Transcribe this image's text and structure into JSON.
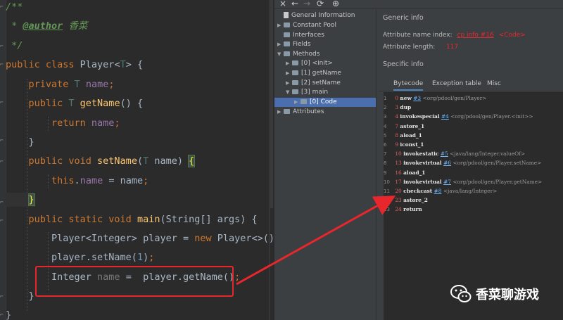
{
  "editor": {
    "lines": [
      {
        "segments": [
          {
            "t": "/**",
            "c": "cmt"
          }
        ]
      },
      {
        "segments": [
          {
            "t": " * ",
            "c": "cmt"
          },
          {
            "t": "@author",
            "c": "tag"
          },
          {
            "t": " 香菜",
            "c": "cmt"
          }
        ]
      },
      {
        "segments": [
          {
            "t": " */",
            "c": "cmt"
          }
        ]
      },
      {
        "segments": [
          {
            "t": "public class ",
            "c": "kw"
          },
          {
            "t": "Player",
            "c": ""
          },
          {
            "t": "<",
            "c": ""
          },
          {
            "t": "T",
            "c": "tp"
          },
          {
            "t": "> {",
            "c": ""
          }
        ]
      },
      {
        "segments": [
          {
            "t": "    private ",
            "c": "kw"
          },
          {
            "t": "T ",
            "c": "tp"
          },
          {
            "t": "name",
            "c": "fld"
          },
          {
            "t": ";",
            "c": "kw"
          }
        ]
      },
      {
        "segments": [
          {
            "t": "    public ",
            "c": "kw"
          },
          {
            "t": "T ",
            "c": "tp"
          },
          {
            "t": "getName",
            "c": "fn"
          },
          {
            "t": "() {",
            "c": ""
          }
        ]
      },
      {
        "segments": [
          {
            "t": "        return ",
            "c": "kw"
          },
          {
            "t": "name",
            "c": "fld"
          },
          {
            "t": ";",
            "c": "kw"
          }
        ]
      },
      {
        "segments": [
          {
            "t": "    }",
            "c": ""
          }
        ]
      },
      {
        "segments": [
          {
            "t": "    public void ",
            "c": "kw"
          },
          {
            "t": "setName",
            "c": "fn"
          },
          {
            "t": "(",
            "c": ""
          },
          {
            "t": "T ",
            "c": "tp"
          },
          {
            "t": "name) ",
            "c": ""
          },
          {
            "t": "{",
            "c": "brace-hl"
          }
        ]
      },
      {
        "segments": [
          {
            "t": "        this",
            "c": "kw"
          },
          {
            "t": ".",
            "c": ""
          },
          {
            "t": "name",
            "c": "fld"
          },
          {
            "t": " = name",
            "c": ""
          },
          {
            "t": ";",
            "c": "kw"
          }
        ]
      },
      {
        "segments": [
          {
            "t": "    ",
            "c": ""
          },
          {
            "t": "}",
            "c": "brace-hl"
          }
        ]
      },
      {
        "segments": [
          {
            "t": "    public static void ",
            "c": "kw"
          },
          {
            "t": "main",
            "c": "fn"
          },
          {
            "t": "(String[] args) {",
            "c": ""
          }
        ]
      },
      {
        "segments": [
          {
            "t": "        Player<Integer> player = ",
            "c": ""
          },
          {
            "t": "new ",
            "c": "kw"
          },
          {
            "t": "Player<>()",
            "c": ""
          },
          {
            "t": ";",
            "c": "kw"
          }
        ]
      },
      {
        "segments": [
          {
            "t": "        player.setName(",
            "c": ""
          },
          {
            "t": "1",
            "c": "num"
          },
          {
            "t": ")",
            "c": ""
          },
          {
            "t": ";",
            "c": "kw"
          }
        ]
      },
      {
        "segments": [
          {
            "t": "        Integer ",
            "c": ""
          },
          {
            "t": "name",
            "c": "muted"
          },
          {
            "t": " =  player.getName()",
            "c": ""
          },
          {
            "t": ";",
            "c": "kw"
          }
        ]
      },
      {
        "segments": [
          {
            "t": "    }",
            "c": ""
          }
        ]
      },
      {
        "segments": [
          {
            "t": "}",
            "c": ""
          }
        ]
      }
    ]
  },
  "toolbar": {
    "close_glyph": "×",
    "back_glyph": "←",
    "forward_glyph": "→",
    "refresh_glyph": "⟳",
    "globe_glyph": "⊕"
  },
  "tree": {
    "items": [
      {
        "label": "General Information",
        "depth": 0,
        "kind": "file",
        "arrow": ""
      },
      {
        "label": "Constant Pool",
        "depth": 0,
        "kind": "folder",
        "arrow": "▶"
      },
      {
        "label": "Interfaces",
        "depth": 0,
        "kind": "folder",
        "arrow": ""
      },
      {
        "label": "Fields",
        "depth": 0,
        "kind": "folder",
        "arrow": "▶"
      },
      {
        "label": "Methods",
        "depth": 0,
        "kind": "folder",
        "arrow": "▼"
      },
      {
        "label": "[0] <init>",
        "depth": 1,
        "kind": "folder",
        "arrow": "▶"
      },
      {
        "label": "[1] getName",
        "depth": 1,
        "kind": "folder",
        "arrow": "▶"
      },
      {
        "label": "[2] setName",
        "depth": 1,
        "kind": "folder",
        "arrow": "▶"
      },
      {
        "label": "[3] main",
        "depth": 1,
        "kind": "folder",
        "arrow": "▼"
      },
      {
        "label": "[0] Code",
        "depth": 2,
        "kind": "folder",
        "arrow": "▶",
        "selected": true
      },
      {
        "label": "Attributes",
        "depth": 0,
        "kind": "folder",
        "arrow": "▶"
      }
    ]
  },
  "info": {
    "section_title": "Generic info",
    "attr_name_label": "Attribute name index:",
    "attr_name_link": "cp info #16",
    "attr_name_value": "<Code>",
    "attr_len_label": "Attribute length:",
    "attr_len_value": "117",
    "specific_title": "Specific info"
  },
  "tabs": [
    "Bytecode",
    "Exception table",
    "Misc"
  ],
  "bytecode": [
    {
      "ln": "1",
      "off": "0",
      "op": "new",
      "ref": "#3",
      "cmt": "<org/pdool/gen/Player>"
    },
    {
      "ln": "2",
      "off": "3",
      "op": "dup",
      "ref": "",
      "cmt": ""
    },
    {
      "ln": "3",
      "off": "4",
      "op": "invokespecial",
      "ref": "#4",
      "cmt": "<org/pdool/gen/Player.<init>>"
    },
    {
      "ln": "4",
      "off": "7",
      "op": "astore_1",
      "ref": "",
      "cmt": ""
    },
    {
      "ln": "5",
      "off": "8",
      "op": "aload_1",
      "ref": "",
      "cmt": ""
    },
    {
      "ln": "6",
      "off": "9",
      "op": "iconst_1",
      "ref": "",
      "cmt": ""
    },
    {
      "ln": "7",
      "off": "10",
      "op": "invokestatic",
      "ref": "#5",
      "cmt": "<java/lang/Integer.valueOf>"
    },
    {
      "ln": "8",
      "off": "13",
      "op": "invokevirtual",
      "ref": "#6",
      "cmt": "<org/pdool/gen/Player.setName>"
    },
    {
      "ln": "9",
      "off": "16",
      "op": "aload_1",
      "ref": "",
      "cmt": ""
    },
    {
      "ln": "10",
      "off": "17",
      "op": "invokevirtual",
      "ref": "#7",
      "cmt": "<org/pdool/gen/Player.getName>"
    },
    {
      "ln": "11",
      "off": "20",
      "op": "checkcast",
      "ref": "#8",
      "cmt": "<java/lang/Integer>"
    },
    {
      "ln": "12",
      "off": "23",
      "op": "astore_2",
      "ref": "",
      "cmt": ""
    },
    {
      "ln": "13",
      "off": "24",
      "op": "return",
      "ref": "",
      "cmt": ""
    }
  ],
  "watermark": {
    "text": "香菜聊游戏",
    "icon": "wechat-icon"
  },
  "colors": {
    "annotation": "#e8272d",
    "selection": "#4b6eaf"
  }
}
